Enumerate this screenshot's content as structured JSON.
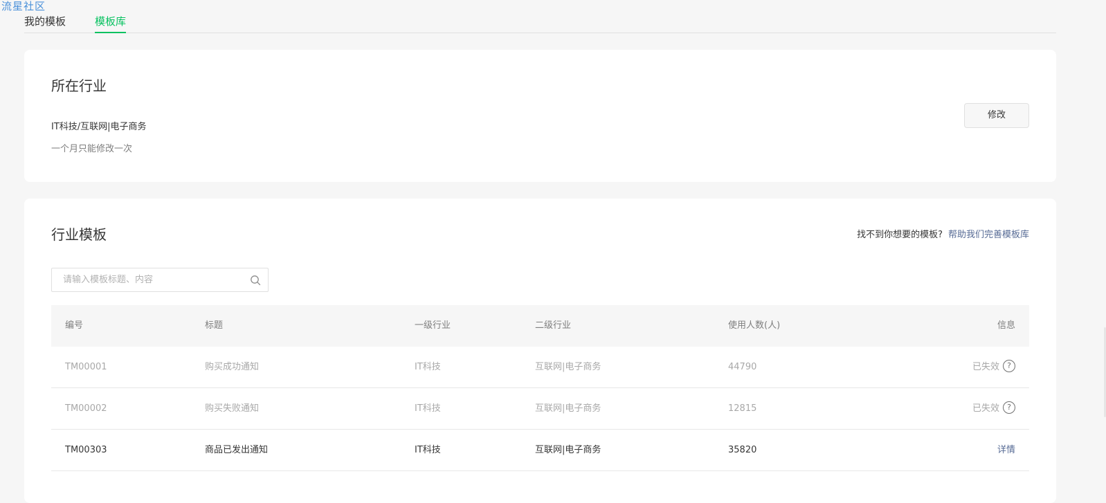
{
  "watermark": "流星社区",
  "tabs": {
    "mine": "我的模板",
    "library": "模板库"
  },
  "industry": {
    "title": "所在行业",
    "value": "IT科技/互联网|电子商务",
    "hint": "一个月只能修改一次",
    "modify_label": "修改"
  },
  "templates": {
    "title": "行业模板",
    "help_prefix": "找不到你想要的模板?",
    "help_link": "帮助我们完善模板库",
    "search_placeholder": "请输入模板标题、内容",
    "columns": {
      "id": "编号",
      "title": "标题",
      "lvl1": "一级行业",
      "lvl2": "二级行业",
      "users": "使用人数(人)",
      "info": "信息"
    },
    "rows": [
      {
        "id": "TM00001",
        "title": "购买成功通知",
        "lvl1": "IT科技",
        "lvl2": "互联网|电子商务",
        "users": "44790",
        "info": "已失效",
        "status": "expired"
      },
      {
        "id": "TM00002",
        "title": "购买失败通知",
        "lvl1": "IT科技",
        "lvl2": "互联网|电子商务",
        "users": "12815",
        "info": "已失效",
        "status": "expired"
      },
      {
        "id": "TM00303",
        "title": "商品已发出通知",
        "lvl1": "IT科技",
        "lvl2": "互联网|电子商务",
        "users": "35820",
        "info": "详情",
        "status": "active"
      }
    ]
  },
  "colors": {
    "accent": "#07c160",
    "link": "#576b95",
    "muted": "#a8a8a8"
  }
}
